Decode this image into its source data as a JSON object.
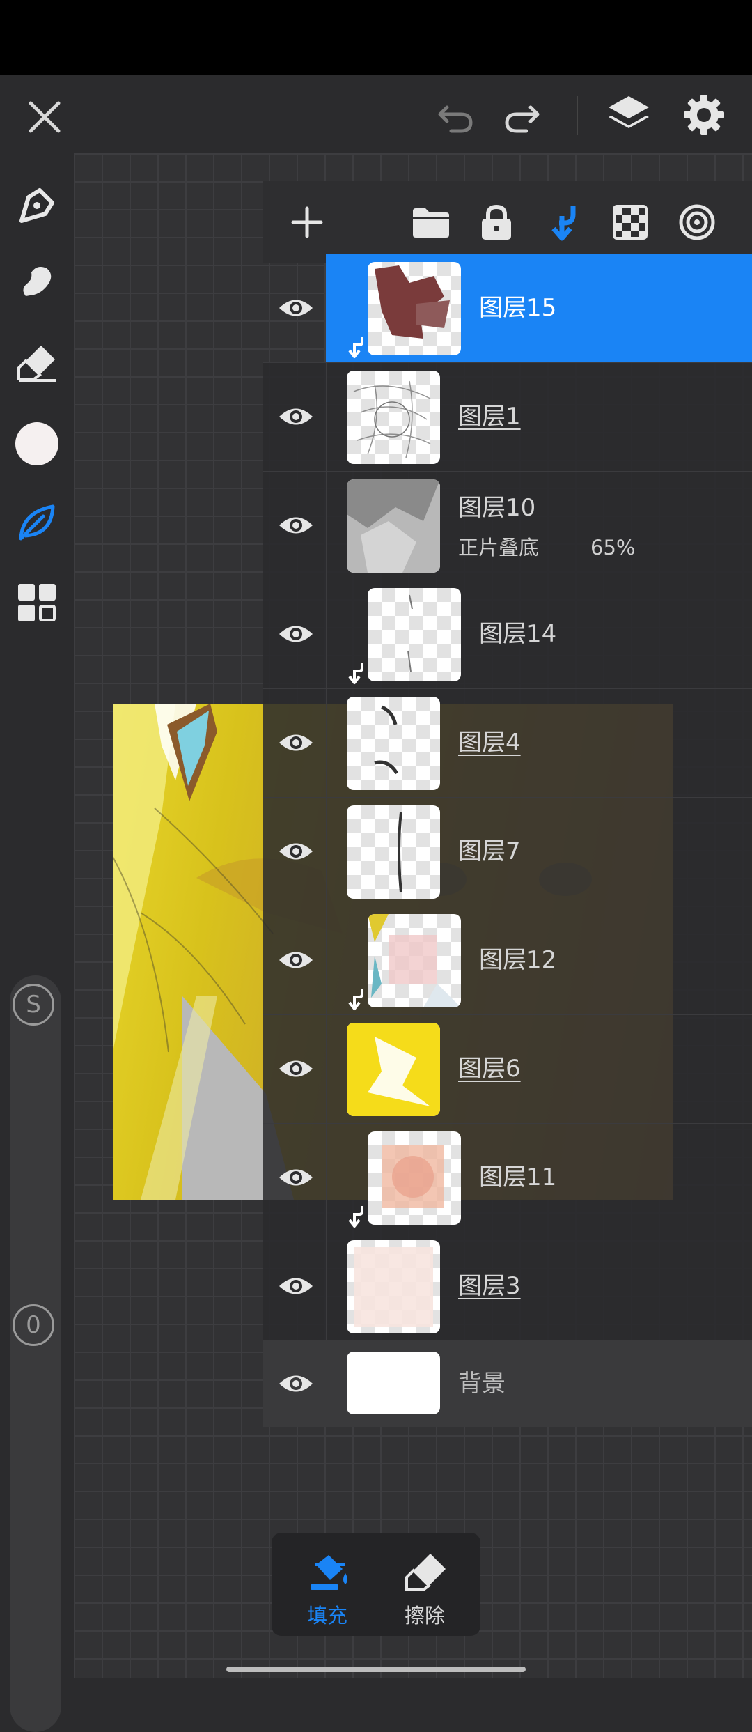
{
  "layers": [
    {
      "name": "图层15",
      "blend": "",
      "opacity": "",
      "selected": true,
      "clipped": true,
      "underline": false
    },
    {
      "name": "图层1",
      "blend": "",
      "opacity": "",
      "selected": false,
      "clipped": false,
      "underline": true
    },
    {
      "name": "图层10",
      "blend": "正片叠底",
      "opacity": "65%",
      "selected": false,
      "clipped": false,
      "underline": false
    },
    {
      "name": "图层14",
      "blend": "",
      "opacity": "",
      "selected": false,
      "clipped": true,
      "underline": false
    },
    {
      "name": "图层4",
      "blend": "",
      "opacity": "",
      "selected": false,
      "clipped": false,
      "underline": true
    },
    {
      "name": "图层7",
      "blend": "",
      "opacity": "",
      "selected": false,
      "clipped": false,
      "underline": false
    },
    {
      "name": "图层12",
      "blend": "",
      "opacity": "",
      "selected": false,
      "clipped": true,
      "underline": false
    },
    {
      "name": "图层6",
      "blend": "",
      "opacity": "",
      "selected": false,
      "clipped": false,
      "underline": true
    },
    {
      "name": "图层11",
      "blend": "",
      "opacity": "",
      "selected": false,
      "clipped": true,
      "underline": false
    },
    {
      "name": "图层3",
      "blend": "",
      "opacity": "",
      "selected": false,
      "clipped": false,
      "underline": true
    }
  ],
  "background_layer": {
    "name": "背景"
  },
  "sliders": {
    "size_label": "S",
    "opacity_label": "0"
  },
  "bottom_popup": {
    "fill_label": "填充",
    "erase_label": "擦除"
  },
  "colors": {
    "accent": "#1a84f5",
    "current_color": "#f5f0f0",
    "background": "#2b2b2d"
  },
  "icons": {
    "top": [
      "close-icon",
      "undo-icon",
      "redo-icon",
      "layers-icon",
      "settings-icon"
    ],
    "tools": [
      "pen-icon",
      "smudge-icon",
      "eraser-icon",
      "color-swatch",
      "leaf-brush-icon",
      "grid-icon"
    ],
    "panel": [
      "add-layer-icon",
      "folder-icon",
      "lock-icon",
      "clip-icon",
      "alpha-lock-icon",
      "layer-mode-icon"
    ]
  }
}
